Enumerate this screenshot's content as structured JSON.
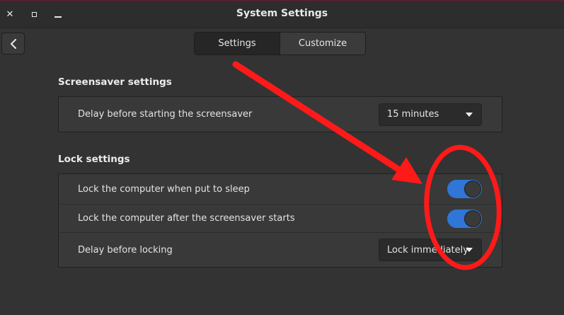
{
  "window": {
    "title": "System Settings",
    "close_glyph": "✕"
  },
  "header": {
    "tabs": [
      {
        "label": "Settings",
        "active": true
      },
      {
        "label": "Customize",
        "active": false
      }
    ]
  },
  "screensaver": {
    "title": "Screensaver settings",
    "rows": [
      {
        "label": "Delay before starting the screensaver",
        "control": "dropdown",
        "value": "15 minutes"
      }
    ]
  },
  "lock": {
    "title": "Lock settings",
    "rows": [
      {
        "label": "Lock the computer when put to sleep",
        "control": "toggle",
        "value": true
      },
      {
        "label": "Lock the computer after the screensaver starts",
        "control": "toggle",
        "value": true
      },
      {
        "label": "Delay before locking",
        "control": "dropdown",
        "value": "Lock immediately"
      }
    ]
  },
  "colors": {
    "accent": "#2f76d6",
    "annotation": "#ff1a1a",
    "background": "#333333"
  },
  "icons": {
    "back": "chevron-left-icon",
    "close": "close-icon",
    "maximize": "maximize-icon",
    "minimize": "minimize-icon",
    "dropdown": "caret-down-icon"
  }
}
